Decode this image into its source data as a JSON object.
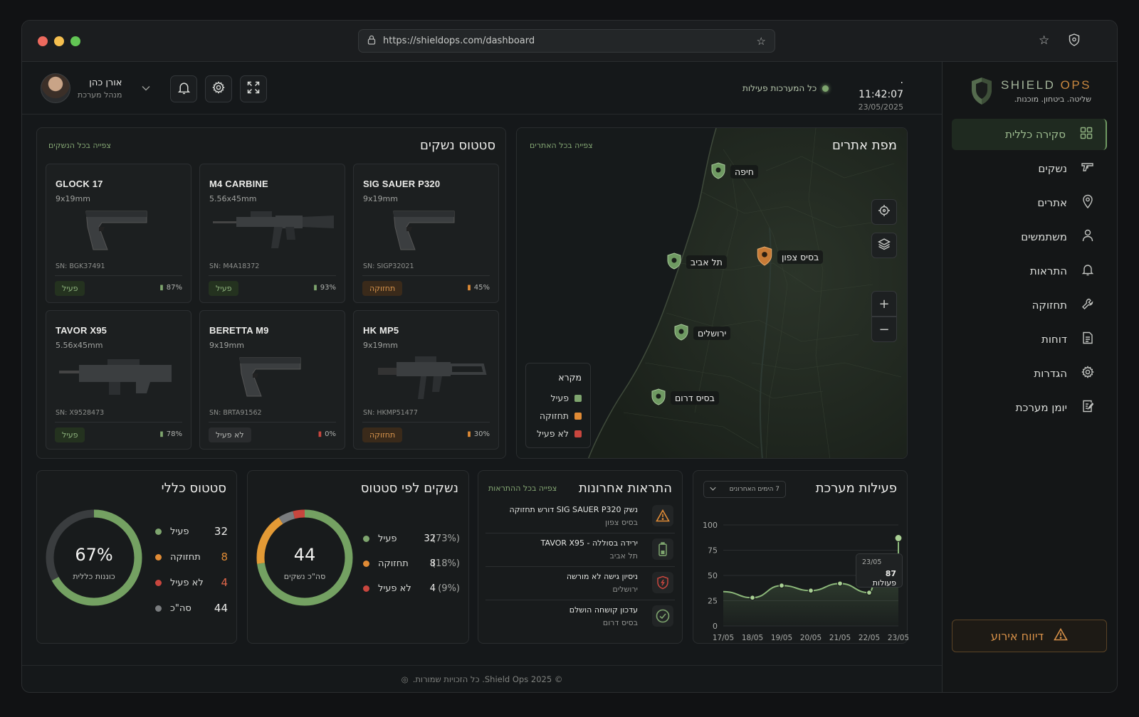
{
  "browser": {
    "url": "https://shieldops.com/dashboard"
  },
  "brand": {
    "name_a": "SHIELD",
    "name_b": "OPS",
    "tagline": "שליטה. ביטחון. מוכנות."
  },
  "nav": [
    {
      "label": "סקירה כללית",
      "icon": "grid-icon",
      "active": true
    },
    {
      "label": "נשקים",
      "icon": "gun-icon"
    },
    {
      "label": "אתרים",
      "icon": "location-pin-icon"
    },
    {
      "label": "משתמשים",
      "icon": "user-icon"
    },
    {
      "label": "התראות",
      "icon": "bell-icon"
    },
    {
      "label": "תחזוקה",
      "icon": "wrench-icon"
    },
    {
      "label": "דוחות",
      "icon": "document-icon"
    },
    {
      "label": "הגדרות",
      "icon": "gear-icon"
    },
    {
      "label": "יומן מערכת",
      "icon": "log-icon"
    }
  ],
  "incident_button": "דיווח אירוע",
  "user": {
    "name": "אורן כהן",
    "role": "מנהל מערכת"
  },
  "system_status": "כל המערכות פעילות",
  "clock": {
    "time": "11:42:07",
    "date": "23/05/2025"
  },
  "weapons": {
    "title": "סטטוס נשקים",
    "view_all": "צפייה בכל הנשקים",
    "items": [
      {
        "name": "SIG SAUER P320",
        "caliber": "9x19mm",
        "sn": "SN: SIGP32021",
        "status": "תחזוקה",
        "status_type": "maint",
        "battery": "45%"
      },
      {
        "name": "M4 CARBINE",
        "caliber": "5.56x45mm",
        "sn": "SN: M4A18372",
        "status": "פעיל",
        "status_type": "active",
        "battery": "93%"
      },
      {
        "name": "GLOCK 17",
        "caliber": "9x19mm",
        "sn": "SN: BGK37491",
        "status": "פעיל",
        "status_type": "active",
        "battery": "87%"
      },
      {
        "name": "HK MP5",
        "caliber": "9x19mm",
        "sn": "SN: HKMP51477",
        "status": "תחזוקה",
        "status_type": "maint",
        "battery": "30%"
      },
      {
        "name": "BERETTA M9",
        "caliber": "9x19mm",
        "sn": "SN: BRTA91562",
        "status": "לא פעיל",
        "status_type": "off",
        "battery": "0%"
      },
      {
        "name": "TAVOR X95",
        "caliber": "5.56x45mm",
        "sn": "SN: X9528473",
        "status": "פעיל",
        "status_type": "active",
        "battery": "78%"
      }
    ]
  },
  "map": {
    "title": "מפת אתרים",
    "view_all": "צפייה בכל האתרים",
    "sites": [
      {
        "name": "חיפה",
        "status": "active"
      },
      {
        "name": "תל אביב",
        "status": "active"
      },
      {
        "name": "בסיס צפון",
        "status": "maint"
      },
      {
        "name": "ירושלים",
        "status": "active"
      },
      {
        "name": "בסיס דרום",
        "status": "active"
      }
    ],
    "legend": {
      "title": "מקרא",
      "items": [
        "פעיל",
        "תחזוקה",
        "לא פעיל"
      ]
    }
  },
  "overall": {
    "title": "סטטוס כללי",
    "percent": "67%",
    "percent_label": "כוננות כללית",
    "rows": [
      {
        "label": "פעיל",
        "value": "32"
      },
      {
        "label": "תחזוקה",
        "value": "8"
      },
      {
        "label": "לא פעיל",
        "value": "4"
      },
      {
        "label": "סה\"כ",
        "value": "44"
      }
    ]
  },
  "by_status": {
    "title": "נשקים לפי סטטוס",
    "total": "44",
    "total_label": "סה\"כ נשקים",
    "rows": [
      {
        "label": "פעיל",
        "value": "32",
        "pct": "(73%)"
      },
      {
        "label": "תחזוקה",
        "value": "8",
        "pct": "(18%)"
      },
      {
        "label": "לא פעיל",
        "value": "4",
        "pct": "(9%)"
      }
    ]
  },
  "alerts": {
    "title": "התראות אחרונות",
    "view_all": "צפייה בכל ההתראות",
    "items": [
      {
        "text": "נשק SIG SAUER P320 דורש תחזוקה",
        "location": "בסיס צפון",
        "icon": "warning-icon"
      },
      {
        "text": "ירידה בסוללה - TAVOR X95",
        "location": "תל אביב",
        "icon": "battery-icon"
      },
      {
        "text": "ניסיון גישה לא מורשה",
        "location": "ירושלים",
        "icon": "shield-alert-icon"
      },
      {
        "text": "עדכון קושחה הושלם",
        "location": "בסיס דרום",
        "icon": "check-circle-icon"
      }
    ]
  },
  "activity": {
    "title": "פעילות מערכת",
    "range": "7 הימים האחרונים",
    "tooltip": {
      "date": "23/05",
      "value": "87",
      "label": "פעולות"
    }
  },
  "chart_data": {
    "type": "area",
    "title": "פעילות מערכת",
    "x": [
      "17/05",
      "18/05",
      "19/05",
      "20/05",
      "21/05",
      "22/05",
      "23/05"
    ],
    "series": [
      {
        "values": [
          34,
          28,
          40,
          35,
          42,
          33,
          54,
          50,
          87
        ]
      }
    ],
    "x_points": [
      0,
      1,
      2,
      3,
      4,
      5,
      5.3,
      6,
      6.0
    ],
    "ylim": [
      0,
      100
    ],
    "yticks": [
      "100",
      "75",
      "50",
      "25",
      "0"
    ]
  },
  "footer": "© 2025 Shield Ops. כל הזכויות שמורות."
}
